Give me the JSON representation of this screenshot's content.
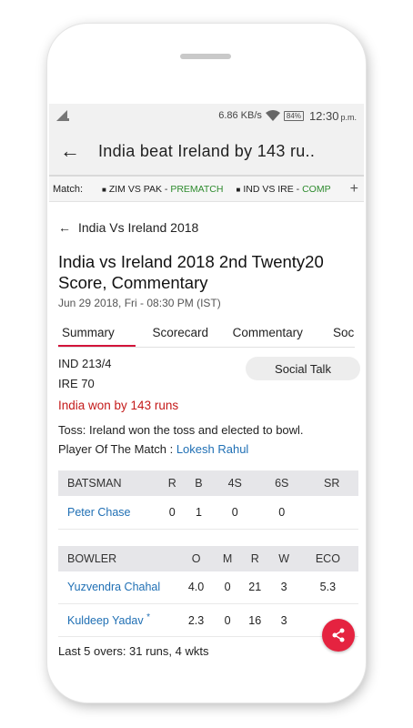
{
  "status_bar": {
    "network_speed": "6.86 KB/s",
    "battery": "84%",
    "time": "12:30",
    "ampm": "p.m."
  },
  "app_bar": {
    "title": "India beat Ireland by 143 ru.."
  },
  "match_bar": {
    "label": "Match:",
    "items": [
      {
        "teams": "ZIM VS PAK - ",
        "status": "PREMATCH"
      },
      {
        "teams": "IND VS IRE - ",
        "status": "COMPLETED"
      }
    ]
  },
  "breadcrumb": "India Vs Ireland 2018",
  "headline": "India vs Ireland 2018 2nd Twenty20 Score, Commentary",
  "date": "Jun 29 2018, Fri - 08:30 PM (IST)",
  "tabs": [
    "Summary",
    "Scorecard",
    "Commentary",
    "Social"
  ],
  "summary": {
    "score_1": "IND 213/4",
    "score_2": "IRE 70",
    "result": "India won by 143 runs",
    "social_talk_label": "Social Talk",
    "toss_label": "Toss:",
    "toss_text": " Ireland won the toss and elected to bowl.",
    "pom_label": "Player Of The Match : ",
    "pom_name": "Lokesh Rahul"
  },
  "batting": {
    "headers": [
      "BATSMAN",
      "R",
      "B",
      "4S",
      "6S",
      "SR"
    ],
    "rows": [
      [
        "Peter Chase",
        "0",
        "1",
        "0",
        "0",
        ""
      ]
    ]
  },
  "bowling": {
    "headers": [
      "BOWLER",
      "O",
      "M",
      "R",
      "W",
      "ECO"
    ],
    "rows": [
      [
        "Yuzvendra Chahal",
        "4.0",
        "0",
        "21",
        "3",
        "5.3"
      ],
      [
        "Kuldeep Yadav",
        "2.3",
        "0",
        "16",
        "3",
        ""
      ]
    ],
    "star": "*"
  },
  "last5": {
    "label": "Last 5 overs:",
    "value": " 31 runs, 4 wkts"
  },
  "colors": {
    "accent": "#d3143a",
    "link": "#1f6fb4",
    "result": "#c41a1a",
    "prematch": "#2e8b2e",
    "fab": "#e52340"
  }
}
